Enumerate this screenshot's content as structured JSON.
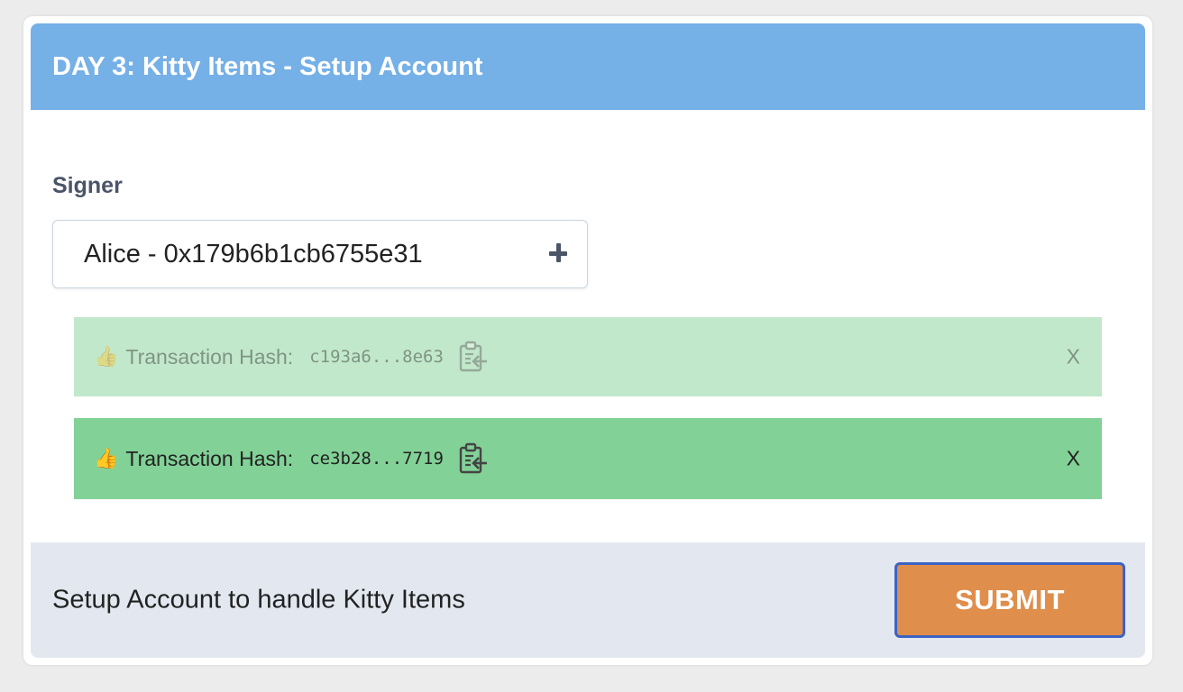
{
  "header": {
    "title": "DAY 3: Kitty Items - Setup Account",
    "background_color": "#75b0e7"
  },
  "signer": {
    "label": "Signer",
    "selected_value": "Alice - 0x179b6b1cb6755e31",
    "add_icon": "plus-icon"
  },
  "transactions": [
    {
      "status": "faded",
      "icon": "thumbs-up-icon",
      "label": "Transaction Hash:",
      "hash": "c193a6...8e63",
      "copy_icon": "clipboard-copy-icon",
      "close_label": "X",
      "background_color": "#c2e8cb"
    },
    {
      "status": "active",
      "icon": "thumbs-up-icon",
      "label": "Transaction Hash:",
      "hash": "ce3b28...7719",
      "copy_icon": "clipboard-copy-icon",
      "close_label": "X",
      "background_color": "#82d197"
    }
  ],
  "footer": {
    "description": "Setup Account to handle Kitty Items",
    "submit_label": "SUBMIT",
    "submit_color": "#e08e4b",
    "background_color": "#e3e8f0"
  }
}
